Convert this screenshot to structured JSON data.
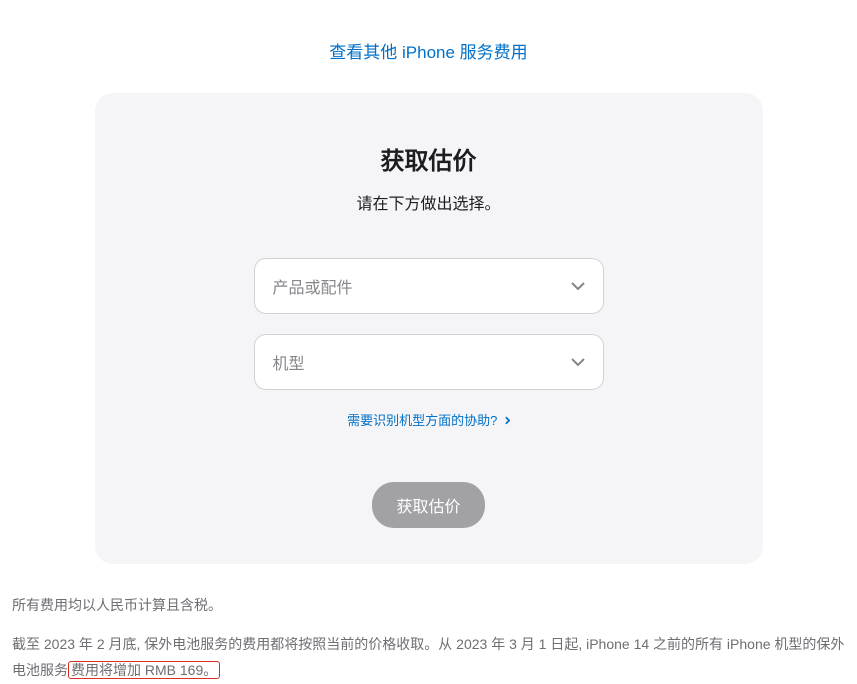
{
  "top_link": "查看其他 iPhone 服务费用",
  "card": {
    "title": "获取估价",
    "subtitle": "请在下方做出选择。",
    "select_product_placeholder": "产品或配件",
    "select_model_placeholder": "机型",
    "help_link": "需要识别机型方面的协助?",
    "submit": "获取估价"
  },
  "footer": {
    "line1": "所有费用均以人民币计算且含税。",
    "line2_pre": "截至 2023 年 2 月底, 保外电池服务的费用都将按照当前的价格收取。从 2023 年 3 月 1 日起, iPhone 14 之前的所有 iPhone 机型的保外电池服务",
    "line2_highlight": "费用将增加 RMB 169。"
  }
}
